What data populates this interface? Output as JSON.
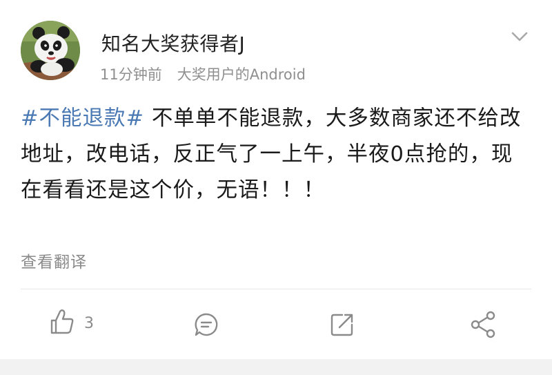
{
  "post": {
    "username": "知名大奖获得者J",
    "time": "11分钟前",
    "source": "大奖用户的Android",
    "hashtag": "#不能退款#",
    "body": " 不单单不能退款，大多数商家还不给改地址，改电话，反正气了一上午，半夜0点抢的，现在看看还是这个价，无语！！！",
    "translate_label": "查看翻译"
  },
  "actions": {
    "like_count": "3"
  },
  "icons": {
    "more": "chevron-down-icon",
    "like": "thumbs-up-icon",
    "comment": "comment-icon",
    "repost": "repost-icon",
    "share": "share-icon"
  },
  "colors": {
    "hashtag": "#4a79b3",
    "secondary_text": "#8f8f8f",
    "icon": "#8a8a8a"
  }
}
